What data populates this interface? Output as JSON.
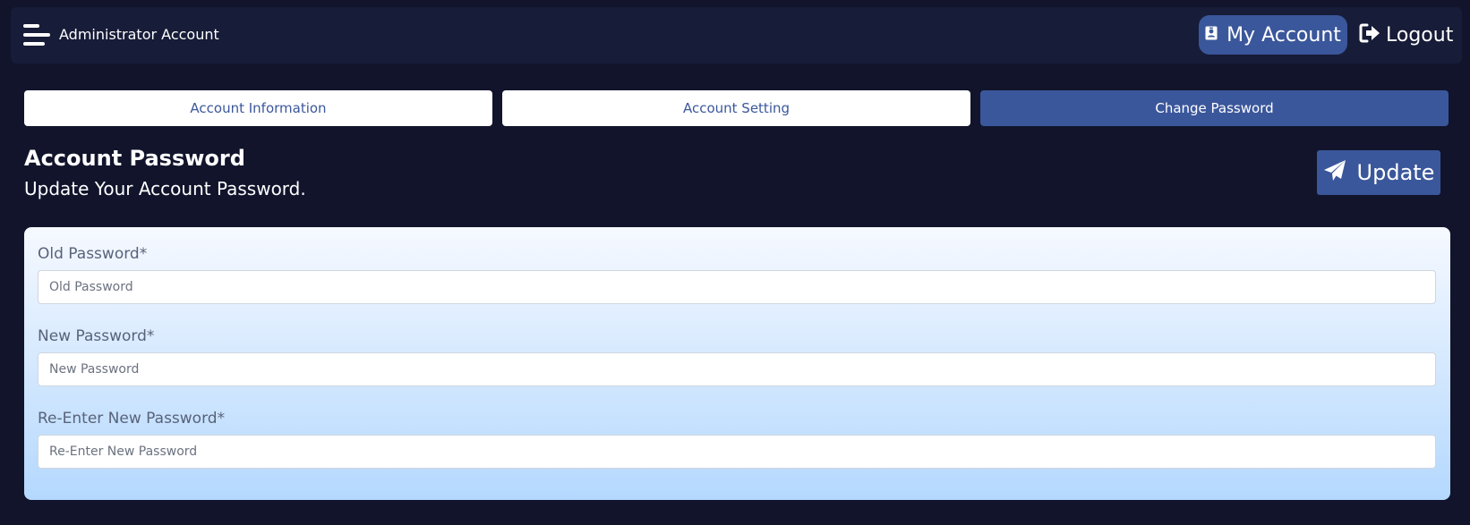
{
  "header": {
    "title": "Administrator Account",
    "my_account_label": "My Account",
    "logout_label": "Logout"
  },
  "tabs": [
    {
      "label": "Account Information",
      "active": false
    },
    {
      "label": "Account Setting",
      "active": false
    },
    {
      "label": "Change Password",
      "active": true
    }
  ],
  "section": {
    "title": "Account Password",
    "subtitle": "Update Your Account Password.",
    "update_label": "Update"
  },
  "form": {
    "fields": [
      {
        "label": "Old Password*",
        "placeholder": "Old Password",
        "value": ""
      },
      {
        "label": "New Password*",
        "placeholder": "New Password",
        "value": ""
      },
      {
        "label": "Re-Enter New Password*",
        "placeholder": "Re-Enter New Password",
        "value": ""
      }
    ]
  },
  "icons": {
    "menu": "hamburger-menu-icon",
    "my_account": "id-badge-icon",
    "logout": "sign-out-icon",
    "update": "paper-plane-icon"
  },
  "colors": {
    "page_background": "#11142b",
    "header_background": "#171c38",
    "accent": "#3b579b",
    "form_gradient_top": "#f6f9ff",
    "form_gradient_bottom": "#b4d8fe",
    "label_text": "#58637a"
  }
}
